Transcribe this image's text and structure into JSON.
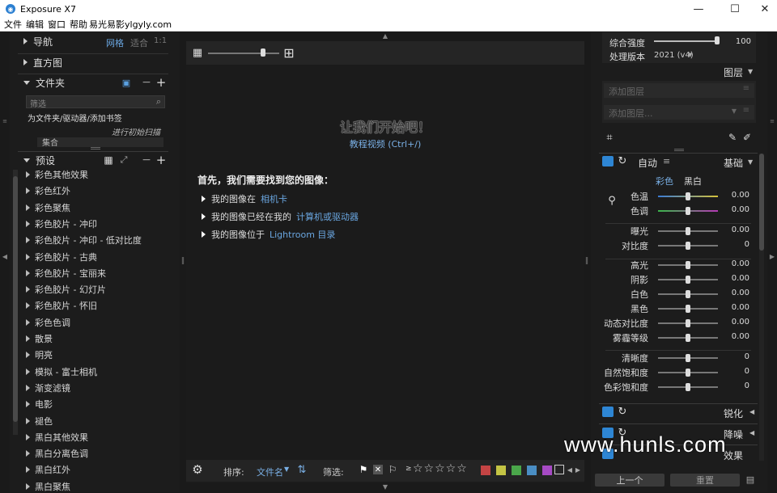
{
  "window": {
    "title": "Exposure X7",
    "minimize": "—",
    "maximize": "☐",
    "close": "✕"
  },
  "menu": [
    "文件",
    "编辑",
    "窗口",
    "帮助"
  ],
  "menu_extra": "易光易影ylgyly.com",
  "left": {
    "nav": {
      "label": "导航",
      "mode_grid": "网格",
      "mode_fit": "适合",
      "mode_1to1": "1:1"
    },
    "histogram": {
      "label": "直方图"
    },
    "folders": {
      "label": "文件夹",
      "filter_placeholder": "筛选",
      "add_link": "为文件夹/驱动器/添加书签",
      "scanning": "进行初始扫描",
      "collection": "集合"
    },
    "presets": {
      "label": "预设",
      "items": [
        "彩色其他效果",
        "彩色红外",
        "彩色聚焦",
        "彩色胶片 - 冲印",
        "彩色胶片 - 冲印 - 低对比度",
        "彩色胶片 - 古典",
        "彩色胶片 - 宝丽来",
        "彩色胶片 - 幻灯片",
        "彩色胶片 - 怀旧",
        "彩色色调",
        "散景",
        "明亮",
        "模拟 - 富士相机",
        "渐变滤镜",
        "电影",
        "褪色",
        "黑白其他效果",
        "黑白分离色调",
        "黑白红外",
        "黑白聚焦"
      ]
    }
  },
  "center": {
    "welcome": "让我们开始吧！",
    "tutorial": "教程视频 (Ctrl+/)",
    "find_heading": "首先，我们需要找到您的图像：",
    "options": [
      {
        "prefix": "我的图像在",
        "link": "相机卡"
      },
      {
        "prefix": "我的图像已经在我的",
        "link": "计算机或驱动器"
      },
      {
        "prefix": "我的图像位于",
        "link": "Lightroom 目录"
      }
    ],
    "bottombar": {
      "sort_label": "排序:",
      "sort_value": "文件名",
      "filter_label": "筛选:",
      "star_prefix": "≥",
      "stars": "☆☆☆☆☆"
    },
    "swatches": [
      "#c44444",
      "#c4c444",
      "#4aa64a",
      "#4a8ec4",
      "#a64ac4"
    ]
  },
  "right": {
    "intensity_label": "综合强度",
    "intensity_value": "100",
    "version_label": "处理版本",
    "version_value": "2021 (v4)",
    "layers_label": "图层",
    "add_layer_1": "添加图层",
    "add_layer_2": "添加图层...",
    "basic": {
      "auto": "自动",
      "title": "基础",
      "tab_color": "彩色",
      "tab_bw": "黑白"
    },
    "adjustments": [
      {
        "label": "色温",
        "value": "0.00"
      },
      {
        "label": "色调",
        "value": "0.00"
      },
      {
        "label": "曝光",
        "value": "0.00"
      },
      {
        "label": "对比度",
        "value": "0"
      },
      {
        "label": "高光",
        "value": "0.00"
      },
      {
        "label": "阴影",
        "value": "0.00"
      },
      {
        "label": "白色",
        "value": "0.00"
      },
      {
        "label": "黑色",
        "value": "0.00"
      },
      {
        "label": "动态对比度",
        "value": "0.00"
      },
      {
        "label": "雾霾等级",
        "value": "0.00"
      },
      {
        "label": "清晰度",
        "value": "0"
      },
      {
        "label": "自然饱和度",
        "value": "0"
      },
      {
        "label": "色彩饱和度",
        "value": "0"
      }
    ],
    "sharpen": "锐化",
    "denoise": "降噪",
    "fx": "效果",
    "prev": "上一个",
    "reset": "重置"
  },
  "watermark": "www.hunls.com"
}
